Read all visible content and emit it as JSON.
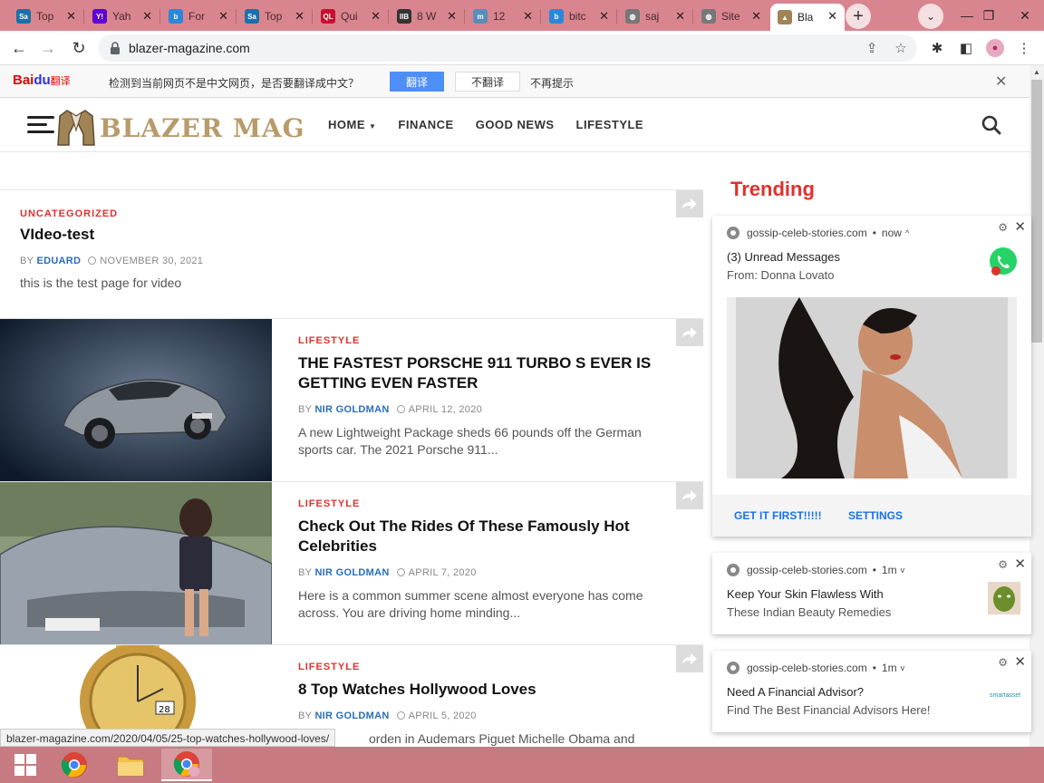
{
  "browser": {
    "tabs": [
      {
        "label": "Top",
        "icon": "sa-icon",
        "color": "#1b6fa8",
        "glyph": "Sa"
      },
      {
        "label": "Yah",
        "icon": "yahoo-icon",
        "color": "#6001d2",
        "glyph": "Y!"
      },
      {
        "label": "For",
        "icon": "bing-icon",
        "color": "#2b88d8",
        "glyph": "b"
      },
      {
        "label": "Top",
        "icon": "sa-icon",
        "color": "#1b6fa8",
        "glyph": "Sa"
      },
      {
        "label": "Qui",
        "icon": "ql-icon",
        "color": "#c8102e",
        "glyph": "QL"
      },
      {
        "label": "8 W",
        "icon": "ibb-icon",
        "color": "#333333",
        "glyph": "IIB"
      },
      {
        "label": "12 ",
        "icon": "msn-icon",
        "color": "#5b8db8",
        "glyph": "m"
      },
      {
        "label": "bitc",
        "icon": "bing-icon",
        "color": "#2b88d8",
        "glyph": "b"
      },
      {
        "label": "saj",
        "icon": "globe-icon",
        "color": "#777777",
        "glyph": "◍"
      },
      {
        "label": "Site",
        "icon": "globe-icon",
        "color": "#777777",
        "glyph": "◍"
      },
      {
        "label": "Bla",
        "icon": "blazer-icon",
        "color": "#a08456",
        "glyph": "▲"
      }
    ],
    "url": "blazer-magazine.com",
    "status_url": "blazer-magazine.com/2020/04/05/25-top-watches-hollywood-loves/"
  },
  "translate_bar": {
    "brand_bai": "Bai",
    "brand_du": "du",
    "brand_fy": "翻译",
    "message": "检测到当前网页不是中文网页，是否要翻译成中文？",
    "translate_label": "翻译",
    "no_translate_label": "不翻译",
    "never_label": "不再提示"
  },
  "site": {
    "logo_text": "BLAZER MAG",
    "nav": [
      "HOME",
      "FINANCE",
      "GOOD NEWS",
      "LIFESTYLE"
    ],
    "trending_label": "Trending"
  },
  "posts": [
    {
      "category": "UNCATEGORIZED",
      "title": "VIdeo-test",
      "by": "BY",
      "author": "EDUARD",
      "date": "NOVEMBER 30, 2021",
      "excerpt": "this is the test page for video"
    },
    {
      "category": "LIFESTYLE",
      "title": "THE FASTEST PORSCHE 911 TURBO S EVER IS GETTING EVEN FASTER",
      "by": "BY",
      "author": "NIR GOLDMAN",
      "date": "APRIL 12, 2020",
      "excerpt": "A new Lightweight Package sheds 66 pounds off the German sports car. The 2021 Porsche 911..."
    },
    {
      "category": "LIFESTYLE",
      "title": "Check Out The Rides Of These Famously Hot Celebrities",
      "by": "BY",
      "author": "NIR GOLDMAN",
      "date": "APRIL 7, 2020",
      "excerpt": "Here is a common summer scene almost everyone has come across. You are driving home minding..."
    },
    {
      "category": "LIFESTYLE",
      "title": "8 Top Watches Hollywood Loves",
      "by": "BY",
      "author": "NIR GOLDMAN",
      "date": "APRIL 5, 2020",
      "excerpt": "orden in Audemars Piguet Michelle Obama and James"
    }
  ],
  "notifications": [
    {
      "source": "gossip-celeb-stories.com",
      "time": "now",
      "title": "(3) Unread Messages",
      "body": "From: Donna Lovato",
      "action1": "GET IT FIRST!!!!!",
      "action2": "SETTINGS"
    },
    {
      "source": "gossip-celeb-stories.com",
      "time": "1m",
      "title": "Keep Your Skin Flawless With",
      "body": "These Indian Beauty Remedies"
    },
    {
      "source": "gossip-celeb-stories.com",
      "time": "1m",
      "title": "Need A Financial Advisor?",
      "body": "Find The Best Financial Advisors Here!",
      "brand": "smartasset"
    }
  ],
  "colors": {
    "accent_red": "#e0312e",
    "author_blue": "#2a6ebb",
    "chrome_tab_bar": "#d9858f"
  }
}
